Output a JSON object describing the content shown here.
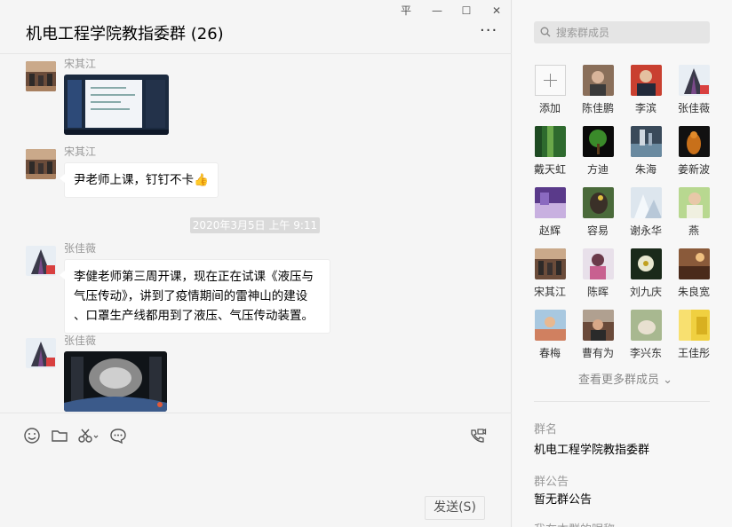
{
  "chat": {
    "title": "机电工程学院教指委群 (26)",
    "window_controls": {
      "pin": "平",
      "minimize": "—",
      "maximize": "☐",
      "close": "✕"
    },
    "more": "···",
    "timestamp": "2020年3月5日 上午 9:11",
    "messages": [
      {
        "sender": "宋其江",
        "type": "image"
      },
      {
        "sender": "宋其江",
        "type": "text",
        "text": "尹老师上课，钉钉不卡👍"
      },
      {
        "sender": "张佳薇",
        "type": "text",
        "lines": [
          "李健老师第三周开课，现在正在试课《液压与",
          "气压传动》，讲到了疫情期间的雷神山的建设",
          "、口罩生产线都用到了液压、气压传动装置。"
        ]
      },
      {
        "sender": "张佳薇",
        "type": "image"
      }
    ],
    "toolbar": {
      "icons": [
        "emoji-icon",
        "folder-icon",
        "scissors-icon",
        "chat-bubble-icon",
        "video-call-icon"
      ],
      "send_label": "发送(S)"
    }
  },
  "side": {
    "search_placeholder": "搜索群成员",
    "add_label": "添加",
    "members": [
      "陈佳鹏",
      "李滨",
      "张佳薇",
      "戴天虹",
      "方迪",
      "朱海",
      "姜新波",
      "赵辉",
      "容易",
      "谢永华",
      "燕",
      "宋其江",
      "陈晖",
      "刘九庆",
      "朱良宽",
      "春梅",
      "曹有为",
      "李兴东",
      "王佳彤"
    ],
    "more_members": "查看更多群成员 ⌄",
    "group_name_label": "群名",
    "group_name": "机电工程学院教指委群",
    "notice_label": "群公告",
    "notice": "暂无群公告",
    "remark_label": "我在本群的昵称"
  }
}
